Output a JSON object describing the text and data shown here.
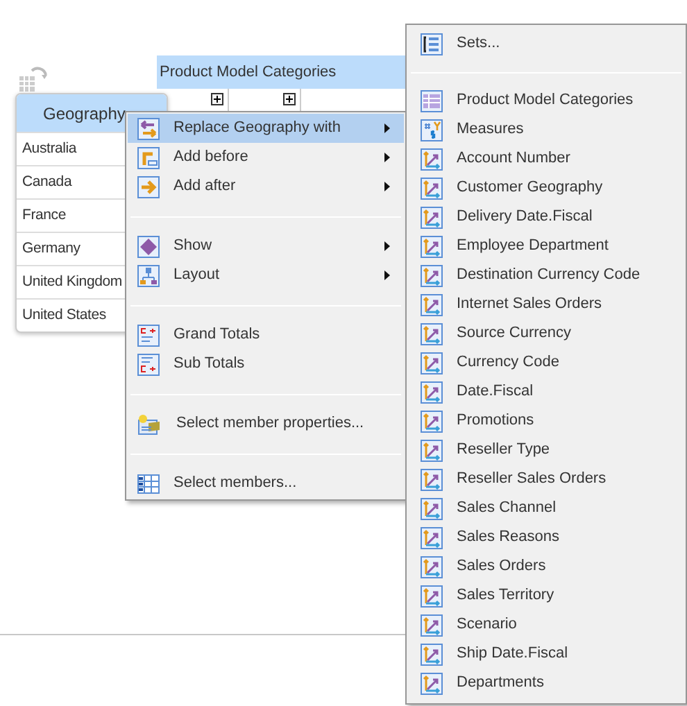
{
  "pivot": {
    "column_header": "Product Model Categories",
    "column_members": [
      {
        "expandable": true
      },
      {
        "expandable": true
      }
    ],
    "row_header": "Geography",
    "rows": [
      "Australia",
      "Canada",
      "France",
      "Germany",
      "United Kingdom",
      "United States"
    ]
  },
  "context_menu": {
    "items": [
      {
        "kind": "item",
        "label": "Replace Geography with",
        "submenu": true,
        "selected": true
      },
      {
        "kind": "item",
        "label": "Add before",
        "submenu": true,
        "selected": false
      },
      {
        "kind": "item",
        "label": "Add after",
        "submenu": true,
        "selected": false
      },
      {
        "kind": "separator"
      },
      {
        "kind": "item",
        "label": "Show",
        "submenu": true,
        "selected": false
      },
      {
        "kind": "item",
        "label": "Layout",
        "submenu": true,
        "selected": false
      },
      {
        "kind": "separator"
      },
      {
        "kind": "item",
        "label": "Grand Totals",
        "submenu": false,
        "selected": false
      },
      {
        "kind": "item",
        "label": "Sub Totals",
        "submenu": false,
        "selected": false
      },
      {
        "kind": "separator"
      },
      {
        "kind": "item",
        "label": "Select member properties...",
        "submenu": false,
        "selected": false
      },
      {
        "kind": "separator"
      },
      {
        "kind": "item",
        "label": "Select members...",
        "submenu": false,
        "selected": false
      }
    ]
  },
  "submenu": {
    "items": [
      {
        "kind": "sets",
        "label": "Sets..."
      },
      {
        "kind": "separator"
      },
      {
        "kind": "table",
        "label": "Product Model Categories"
      },
      {
        "kind": "measures",
        "label": "Measures"
      },
      {
        "kind": "hierarchy",
        "label": "Account Number"
      },
      {
        "kind": "hierarchy",
        "label": "Customer Geography"
      },
      {
        "kind": "hierarchy",
        "label": "Delivery Date.Fiscal"
      },
      {
        "kind": "hierarchy",
        "label": "Employee Department"
      },
      {
        "kind": "hierarchy",
        "label": "Destination Currency Code"
      },
      {
        "kind": "hierarchy",
        "label": "Internet Sales Orders"
      },
      {
        "kind": "hierarchy",
        "label": "Source Currency"
      },
      {
        "kind": "hierarchy",
        "label": "Currency Code"
      },
      {
        "kind": "hierarchy",
        "label": "Date.Fiscal"
      },
      {
        "kind": "hierarchy",
        "label": "Promotions"
      },
      {
        "kind": "hierarchy",
        "label": "Reseller Type"
      },
      {
        "kind": "hierarchy",
        "label": "Reseller Sales Orders"
      },
      {
        "kind": "hierarchy",
        "label": "Sales Channel"
      },
      {
        "kind": "hierarchy",
        "label": "Sales Reasons"
      },
      {
        "kind": "hierarchy",
        "label": "Sales Orders"
      },
      {
        "kind": "hierarchy",
        "label": "Sales Territory"
      },
      {
        "kind": "hierarchy",
        "label": "Scenario"
      },
      {
        "kind": "hierarchy",
        "label": "Ship Date.Fiscal"
      },
      {
        "kind": "hierarchy",
        "label": "Departments"
      }
    ]
  }
}
